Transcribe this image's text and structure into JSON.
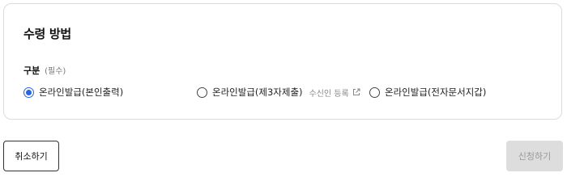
{
  "section": {
    "title": "수령 방법",
    "field_label": "구분",
    "required_tag": "(필수)"
  },
  "options": [
    {
      "label": "온라인발급(본인출력)",
      "selected": true
    },
    {
      "label": "온라인발급(제3자제출)",
      "selected": false,
      "sub_link": "수신인 등록",
      "sub_icon": "external-link-icon"
    },
    {
      "label": "온라인발급(전자문서지갑)",
      "selected": false
    }
  ],
  "buttons": {
    "cancel": "취소하기",
    "apply": "신청하기"
  },
  "colors": {
    "accent": "#2563eb",
    "disabled_bg": "#dddddd",
    "disabled_text": "#9a9a9a",
    "border": "#dcdcdc"
  }
}
